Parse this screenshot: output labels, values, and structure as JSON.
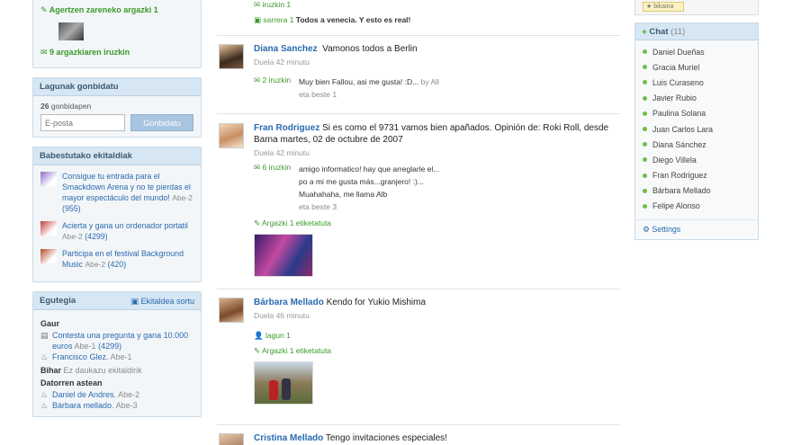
{
  "left": {
    "top": {
      "line1": "Agertzen zareneko argazki 1",
      "line2": "9 argazkiaren iruzkin"
    },
    "invite": {
      "title": "Lagunak gonbidatu",
      "count": "26",
      "count_label": "gonbidapen",
      "placeholder": "E-posta",
      "button": "Gonbidatu"
    },
    "favorites": {
      "title": "Babestutako ekitaldiak",
      "items": [
        {
          "text": "Consigue tu entrada para el Smackdown Arena y no te pierdas  el mayor espectáculo del mundo!",
          "meta": "Abe-2",
          "count": "955",
          "color": "#8b6cc7"
        },
        {
          "text": "Acierta y gana un ordenador portatil",
          "meta": "Abe-2",
          "count": "4299",
          "color": "#c23b3b"
        },
        {
          "text": "Participa en el festival Background Music",
          "meta": "Abe-2",
          "count": "420",
          "color": "#b34a2a"
        }
      ]
    },
    "calendar": {
      "title": "Egutegia",
      "create": "Ekitaldea sortu",
      "today_label": "Gaur",
      "today": [
        {
          "text": "Contesta una pregunta y gana 10.000 euros",
          "meta": "Abe-1",
          "count": "4299"
        },
        {
          "text": "Francisco Glez.",
          "meta": "Abe-1"
        }
      ],
      "tomorrow_label": "Bihar",
      "tomorrow_text": "Ez daukazu ekitaldirik",
      "week_label": "Datorren astean",
      "week": [
        {
          "text": "Daniel de Andres.",
          "meta": "Abe-2"
        },
        {
          "text": "Bárbara mellado.",
          "meta": "Abe-3"
        }
      ]
    }
  },
  "feed": {
    "top": {
      "comment_count": "iruzkin 1",
      "author": "sarrera 1",
      "text": "Todos a venecia. Y esto es real!"
    },
    "posts": [
      {
        "author": "Diana Sanchez",
        "text": "Vamonos todos a Berlin",
        "time": "Duela 42 minutu",
        "comment_count": "2 iruzkin",
        "comment": "Muy bien Fallou, asi me gusta! :D...",
        "comment_author": "by All",
        "comment_time": "eta beste 1"
      },
      {
        "author": "Fran Rodriguez",
        "text": "Si es como el 9731 vamos bien apañados. Opinión de: Roki Roll, desde Barna martes, 02 de octubre de 2007",
        "time": "Duela 42 minutu",
        "comment_count": "6 iruzkin",
        "comment_lines": [
          "amigo informatico! hay que arreglarle el...",
          "po a mi me gusta más...granjero! :)...",
          "Muahahaha, me llama Alb"
        ],
        "comment_time": "eta beste 3",
        "tag": "Argazki 1 etiketatuta"
      },
      {
        "author": "Bárbara Mellado",
        "text": "Kendo for Yukio Mishima",
        "time": "Duela 46 minutu",
        "friend": "lagun 1",
        "tag": "Argazki 1 etiketatuta"
      },
      {
        "author": "Cristina Mellado",
        "text": "Tengo invitaciones especiales!"
      }
    ]
  },
  "right": {
    "top_button": "bikaina",
    "chat": {
      "title": "Chat",
      "count": "(11)",
      "users": [
        "Daniel Dueñas",
        "Gracia Muriel",
        "Luis Curaseno",
        "Javier Rubio",
        "Paulina Solana",
        "Juan Carlos Lara",
        "Diana Sánchez",
        "Diego Villela",
        "Fran Rodriguez",
        "Bárbara Mellado",
        "Felipe Alonso"
      ],
      "settings": "Settings"
    }
  }
}
